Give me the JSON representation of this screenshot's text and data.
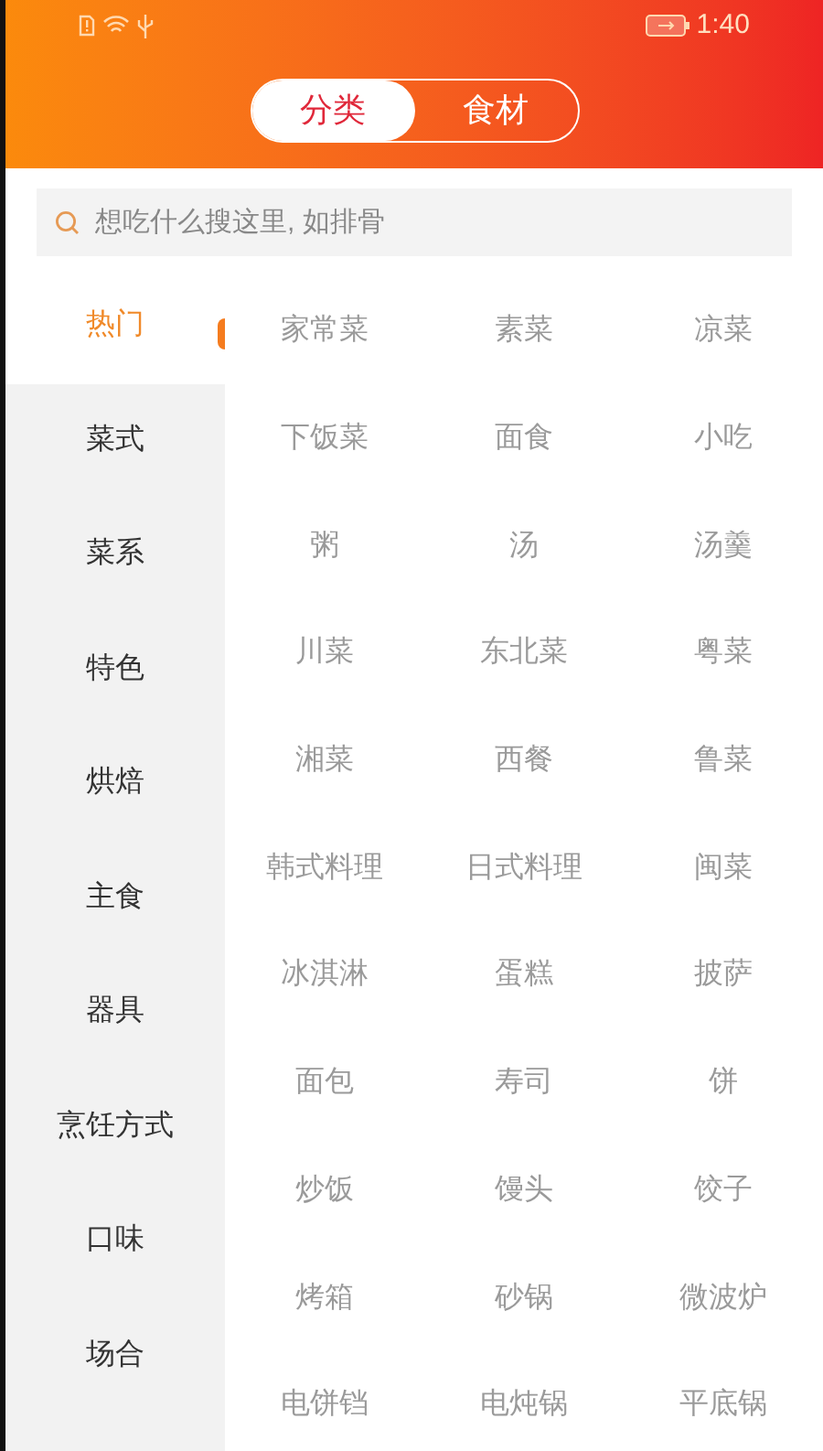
{
  "status_bar": {
    "time": "1:40"
  },
  "tabs": [
    {
      "label": "分类",
      "selected": true
    },
    {
      "label": "食材",
      "selected": false
    }
  ],
  "search": {
    "placeholder": "想吃什么搜这里, 如排骨"
  },
  "sidebar": {
    "items": [
      {
        "label": "热门",
        "selected": true
      },
      {
        "label": "菜式",
        "selected": false
      },
      {
        "label": "菜系",
        "selected": false
      },
      {
        "label": "特色",
        "selected": false
      },
      {
        "label": "烘焙",
        "selected": false
      },
      {
        "label": "主食",
        "selected": false
      },
      {
        "label": "器具",
        "selected": false
      },
      {
        "label": "烹饪方式",
        "selected": false
      },
      {
        "label": "口味",
        "selected": false
      },
      {
        "label": "场合",
        "selected": false
      }
    ]
  },
  "categories": [
    "家常菜",
    "素菜",
    "凉菜",
    "下饭菜",
    "面食",
    "小吃",
    "粥",
    "汤",
    "汤羹",
    "川菜",
    "东北菜",
    "粤菜",
    "湘菜",
    "西餐",
    "鲁菜",
    "韩式料理",
    "日式料理",
    "闽菜",
    "冰淇淋",
    "蛋糕",
    "披萨",
    "面包",
    "寿司",
    "饼",
    "炒饭",
    "馒头",
    "饺子",
    "烤箱",
    "砂锅",
    "微波炉",
    "电饼铛",
    "电炖锅",
    "平底锅"
  ]
}
